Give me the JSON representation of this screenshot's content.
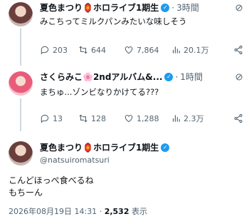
{
  "tweets": [
    {
      "name": "夏色まつり🏮ホロライブ1期生",
      "time": "3時間",
      "text": "みこちってミルクパンみたいな味しそう",
      "replies": "203",
      "retweets": "644",
      "likes": "7,864",
      "views": "20.1万"
    },
    {
      "name": "さくらみこ🌸2ndアルバム&...",
      "time": "1時間",
      "text": "まちゅ...ゾンビなりかけてる???",
      "replies": "13",
      "retweets": "128",
      "likes": "1,288",
      "views": "2.3万"
    }
  ],
  "main": {
    "name": "夏色まつり🏮ホロライブ1期生",
    "handle": "@natsuiromatsuri",
    "text_line1": "こんどほっぺ食べるね",
    "text_line2": "もちーん",
    "timestamp": "2026年08月19日 14:31",
    "separator": "·",
    "views_count": "2,532",
    "views_label": "表示"
  },
  "ui": {
    "dot": "·"
  },
  "colors": {
    "verified": "#1d9bf0",
    "muted": "#536471",
    "text": "#0f1419"
  }
}
